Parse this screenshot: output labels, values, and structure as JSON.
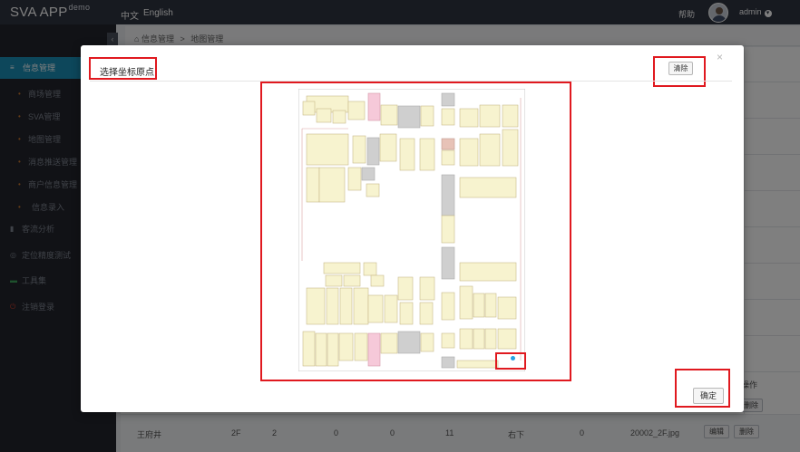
{
  "app": {
    "logo": "SVA APP",
    "logo_suffix": "demo",
    "lang_zh": "中文",
    "lang_en": "English",
    "help": "帮助",
    "user": "admin",
    "avatar_icon": "user-avatar"
  },
  "sidebar": {
    "toggle_icon": "chevron-left-icon",
    "group": "信息管理",
    "subitems": [
      {
        "label": "商场管理",
        "icon": "dot-icon"
      },
      {
        "label": "SVA管理",
        "icon": "dot-icon"
      },
      {
        "label": "地图管理",
        "icon": "dot-icon"
      },
      {
        "label": "消息推送管理",
        "icon": "dot-icon"
      },
      {
        "label": "商户信息管理",
        "icon": "dot-icon"
      },
      {
        "label": "信息录入",
        "icon": "dot-icon"
      }
    ],
    "sections": [
      {
        "label": "客流分析",
        "icon": "bar-chart-icon"
      },
      {
        "label": "定位精度测试",
        "icon": "target-icon"
      },
      {
        "label": "工具集",
        "icon": "toolbox-icon"
      },
      {
        "label": "注销登录",
        "icon": "power-icon"
      }
    ]
  },
  "breadcrumb": {
    "home_icon": "home-icon",
    "items": [
      "信息管理",
      "地图管理"
    ],
    "separator": ">"
  },
  "table_bg": {
    "ops_header": "操作",
    "row": [
      "王府井",
      "2F",
      "2",
      "0",
      "0",
      "11",
      "右下",
      "0",
      "20002_2F.jpg"
    ],
    "edit": "编辑",
    "delete": "删除"
  },
  "modal": {
    "title": "选择坐标原点",
    "close_icon": "close-icon",
    "clear_label": "清除",
    "confirm_label": "确定",
    "map_image": "floor-plan-map"
  },
  "colors": {
    "annotation_red": "#e0191f",
    "sidebar_active": "#1b8fb7",
    "topbar": "#2f3441",
    "origin_marker": "#27a1e3"
  }
}
